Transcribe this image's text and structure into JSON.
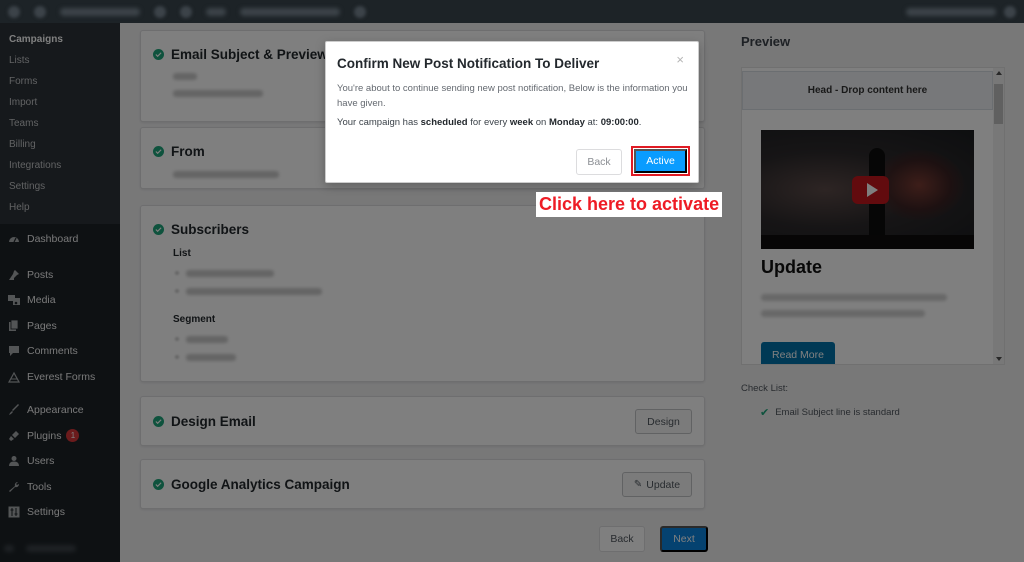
{
  "admin_bar": {
    "obscured": true
  },
  "sidebar": {
    "submenu": [
      {
        "label": "Campaigns",
        "current": true
      },
      {
        "label": "Lists"
      },
      {
        "label": "Forms"
      },
      {
        "label": "Import"
      },
      {
        "label": "Teams"
      },
      {
        "label": "Billing"
      },
      {
        "label": "Integrations"
      },
      {
        "label": "Settings"
      },
      {
        "label": "Help"
      }
    ],
    "menu": [
      {
        "label": "Dashboard",
        "icon": "dashboard-icon"
      },
      {
        "label": "Posts",
        "icon": "pin-icon"
      },
      {
        "label": "Media",
        "icon": "media-icon"
      },
      {
        "label": "Pages",
        "icon": "pages-icon"
      },
      {
        "label": "Comments",
        "icon": "comment-icon"
      },
      {
        "label": "Everest Forms",
        "icon": "everest-forms-icon"
      },
      {
        "label": "Appearance",
        "icon": "paintbrush-icon"
      },
      {
        "label": "Plugins",
        "icon": "plugin-icon",
        "badge": "1"
      },
      {
        "label": "Users",
        "icon": "user-icon"
      },
      {
        "label": "Tools",
        "icon": "wrench-icon"
      },
      {
        "label": "Settings",
        "icon": "settings-icon"
      }
    ]
  },
  "main": {
    "sections": [
      {
        "title": "Email Subject & Preview",
        "status": "complete"
      },
      {
        "title": "From",
        "status": "complete"
      },
      {
        "title": "Subscribers",
        "status": "complete",
        "list_label": "List",
        "segment_label": "Segment"
      },
      {
        "title": "Design Email",
        "status": "complete",
        "button": "Design"
      },
      {
        "title": "Google Analytics Campaign",
        "status": "complete",
        "button": "Update"
      }
    ],
    "back_label": "Back",
    "next_label": "Next"
  },
  "preview": {
    "title": "Preview",
    "head_text": "Head - Drop content here",
    "post_title": "Update",
    "read_more": "Read More",
    "checklist_label": "Check List:",
    "checklist_items": [
      "Email Subject line is standard"
    ]
  },
  "modal": {
    "title": "Confirm New Post Notification To Deliver",
    "close": "×",
    "intro": "You're about to continue sending new post notification, Below is the information you have given.",
    "schedule": {
      "prefix": "Your campaign has ",
      "status": "scheduled",
      "mid1": " for every ",
      "frequency": "week",
      "mid2": " on ",
      "day": "Monday",
      "mid3": " at: ",
      "time": "09:00:00",
      "suffix": "."
    },
    "back_label": "Back",
    "active_label": "Active"
  },
  "annotation": {
    "text": "Click here to activate",
    "color": "#ee1c25"
  },
  "colors": {
    "accent": "#0a9cff",
    "success": "#1da57a",
    "highlight": "#e01b24"
  }
}
